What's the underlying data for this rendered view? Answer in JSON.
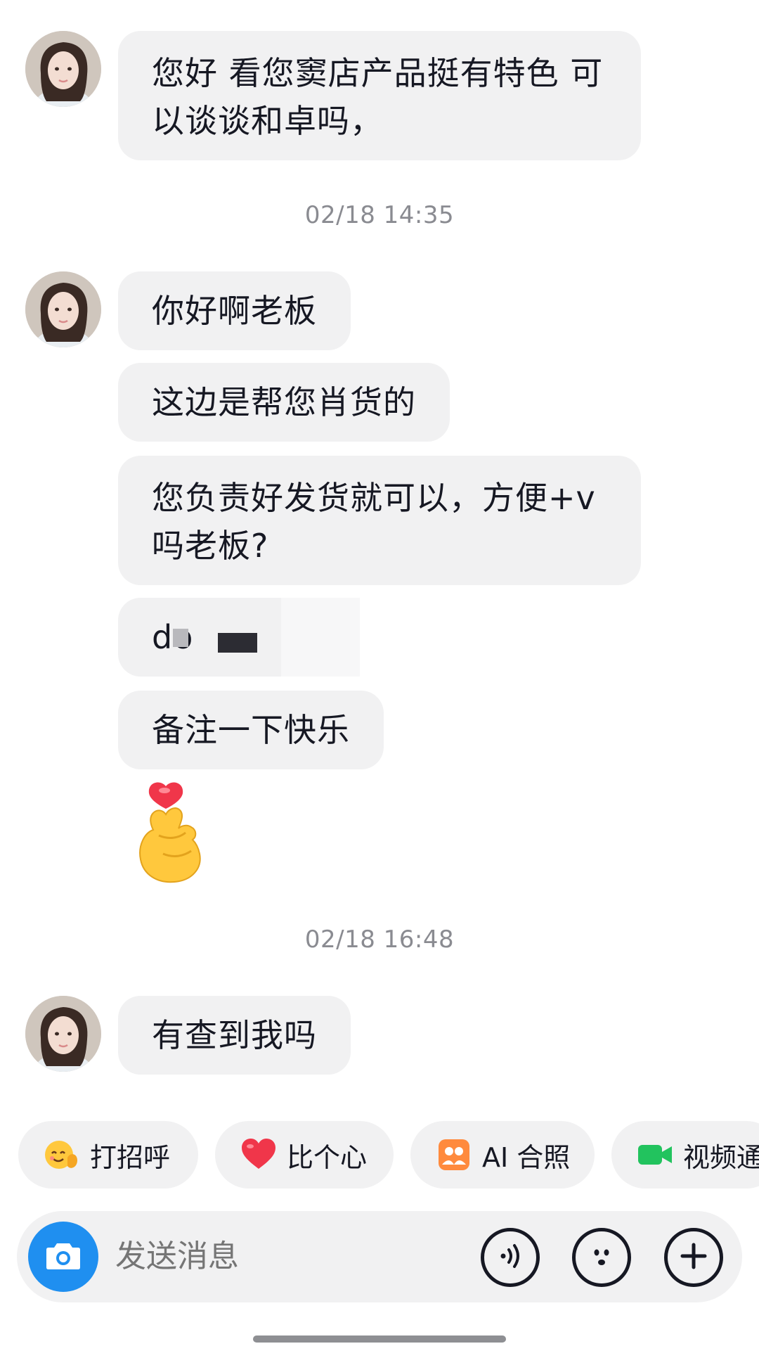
{
  "messages": {
    "m1": "您好 看您窦店产品挺有特色 可以谈谈和卓吗，",
    "time1": "02/18 14:35",
    "m2": "你好啊老板",
    "m3": "这边是帮您肖货的",
    "m4": "您负责好发货就可以，方便+v吗老板?",
    "m5": "do",
    "m6": "备注一下快乐",
    "time2": "02/18 16:48",
    "m7": "有查到我吗"
  },
  "quick_actions": [
    {
      "label": "打招呼",
      "icon": "wave-face-icon"
    },
    {
      "label": "比个心",
      "icon": "heart-icon"
    },
    {
      "label": "AI 合照",
      "icon": "ai-photo-icon"
    },
    {
      "label": "视频通",
      "icon": "video-call-icon"
    }
  ],
  "composer": {
    "placeholder": "发送消息"
  },
  "icons": {
    "camera": "camera-icon",
    "voice": "voice-icon",
    "emoji": "emoji-icon",
    "plus": "plus-icon",
    "sticker": "finger-heart-sticker"
  },
  "colors": {
    "bubble": "#f1f1f2",
    "accent": "#1f8ff0",
    "timestamp": "#8a8b91"
  }
}
